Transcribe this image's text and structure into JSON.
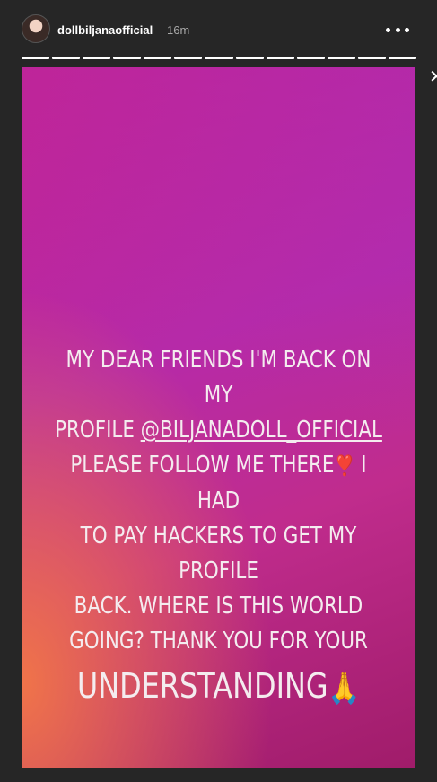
{
  "header": {
    "username": "dollbiljanaofficial",
    "timestamp": "16m",
    "more_icon": "more-dots-icon",
    "progress_segments": 13
  },
  "story": {
    "line1": "MY DEAR FRIENDS I'M BACK ON MY",
    "line2_prefix": "PROFILE ",
    "line2_mention": "@BILJANADOLL_OFFICIAL",
    "line3": "PLEASE FOLLOW ME THERE",
    "heart_emoji": "❣️",
    "line3_suffix": " I HAD",
    "line4": "TO PAY HACKERS TO GET MY PROFILE",
    "line5": "BACK. WHERE IS THIS WORLD",
    "line6": "GOING? THANK YOU FOR YOUR",
    "line7": "UNDERSTANDING",
    "hands_emoji": "🙏",
    "colors": {
      "gradient_start": "#c7218c",
      "gradient_mid": "#b62aa8",
      "gradient_end": "#a01c6a",
      "corner_glow": "#f37846"
    }
  }
}
